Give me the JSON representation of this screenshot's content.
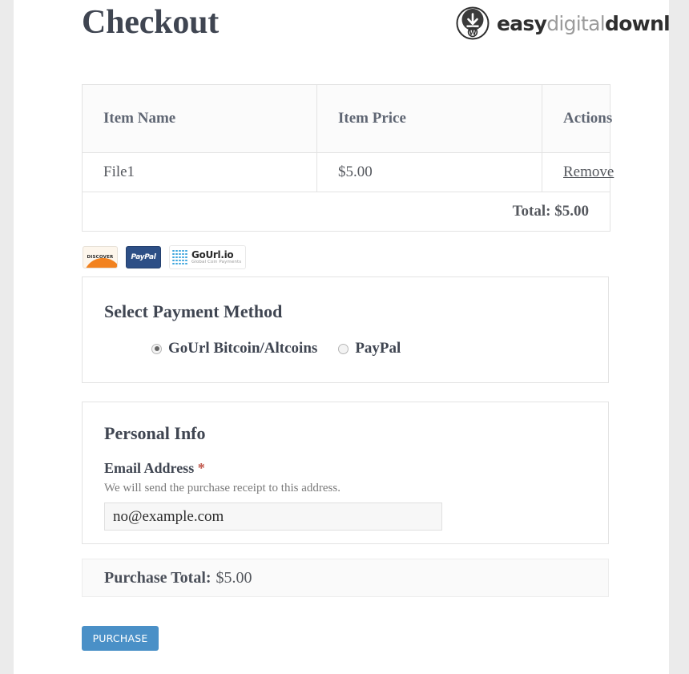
{
  "header": {
    "title": "Checkout",
    "brand": {
      "word1": "easy",
      "word2": "digital",
      "word3": "downloads"
    }
  },
  "cart": {
    "columns": [
      "Item Name",
      "Item Price",
      "Actions"
    ],
    "rows": [
      {
        "item_name": "File1",
        "item_price": "$5.00",
        "action_label": "Remove"
      }
    ],
    "total_label": "Total:",
    "total_amount": "$5.00"
  },
  "payment_badges": [
    {
      "name": "discover",
      "label": "DISCOVER"
    },
    {
      "name": "paypal",
      "label": "PayPal"
    },
    {
      "name": "gourl",
      "label": "GoUrl.io",
      "tagline": "Global Coin Payments"
    }
  ],
  "payment_method": {
    "heading": "Select Payment Method",
    "options": [
      {
        "label": "GoUrl Bitcoin/Altcoins",
        "selected": true
      },
      {
        "label": "PayPal",
        "selected": false
      }
    ]
  },
  "personal_info": {
    "heading": "Personal Info",
    "email_label": "Email Address",
    "required_marker": "*",
    "email_help": "We will send the purchase receipt to this address.",
    "email_value": "no@example.com",
    "email_placeholder": "no@example.com"
  },
  "purchase": {
    "total_label": "Purchase Total:",
    "total_amount": "$5.00",
    "button_label": "PURCHASE"
  },
  "colors": {
    "accent_button": "#4a90c7",
    "heading_text": "#3f4551",
    "gourl_blue": "#3ea6dd",
    "paypal_navy": "#2d4f86",
    "discover_orange": "#f2821f",
    "required_red": "#c0564a"
  }
}
